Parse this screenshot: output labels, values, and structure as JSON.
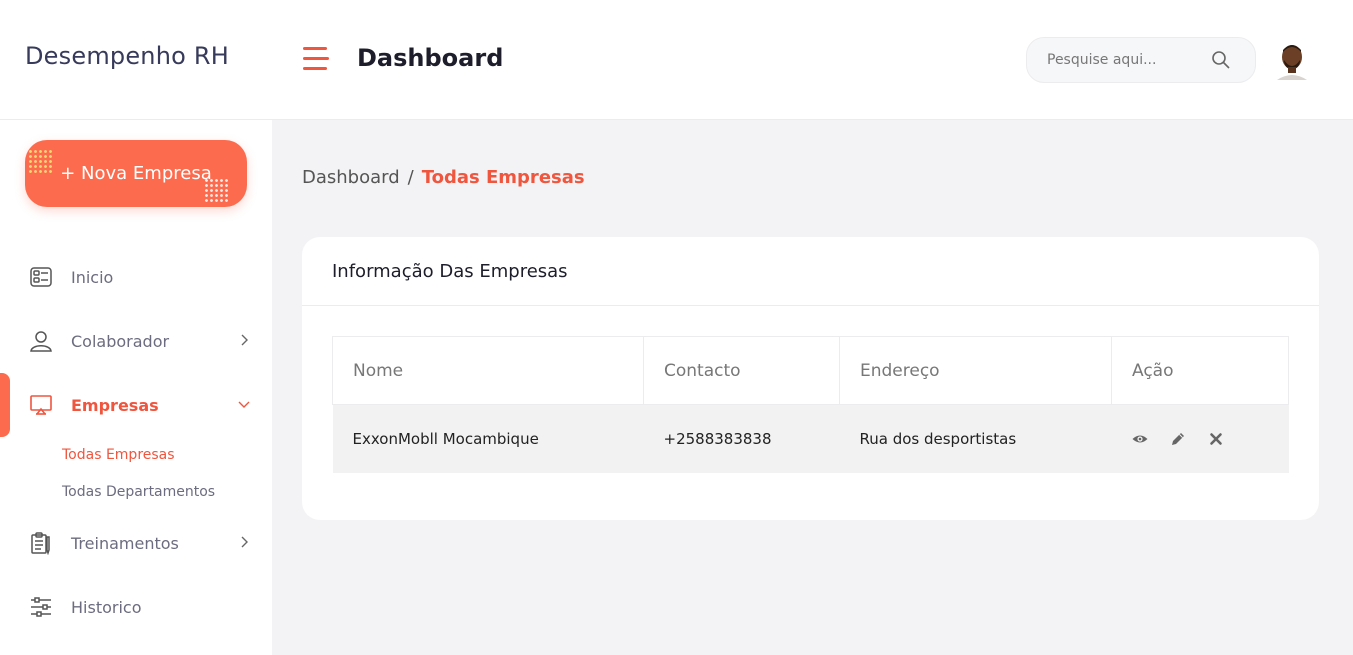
{
  "app": {
    "brand": "Desempenho RH"
  },
  "sidebar": {
    "new_button": "+ Nova Empresa",
    "items": [
      {
        "label": "Inicio",
        "icon": "dashboard-icon"
      },
      {
        "label": "Colaborador",
        "icon": "user-icon"
      },
      {
        "label": "Empresas",
        "icon": "monitor-icon"
      },
      {
        "label": "Treinamentos",
        "icon": "clipboard-icon"
      },
      {
        "label": "Historico",
        "icon": "sliders-icon"
      }
    ],
    "empresas_sub": [
      "Todas Empresas",
      "Todas Departamentos"
    ]
  },
  "header": {
    "title": "Dashboard",
    "search_placeholder": "Pesquise aqui..."
  },
  "breadcrumb": {
    "root": "Dashboard",
    "separator": "/",
    "current": "Todas Empresas"
  },
  "card": {
    "title": "Informação Das Empresas",
    "columns": [
      "Nome",
      "Contacto",
      "Endereço",
      "Ação"
    ],
    "rows": [
      {
        "nome": "ExxonMobll Mocambique",
        "contacto": "+2588383838",
        "endereco": "Rua dos desportistas"
      }
    ]
  },
  "colors": {
    "accent": "#fd6b4e",
    "accent_text": "#f0553e",
    "muted": "#6c6c80"
  }
}
